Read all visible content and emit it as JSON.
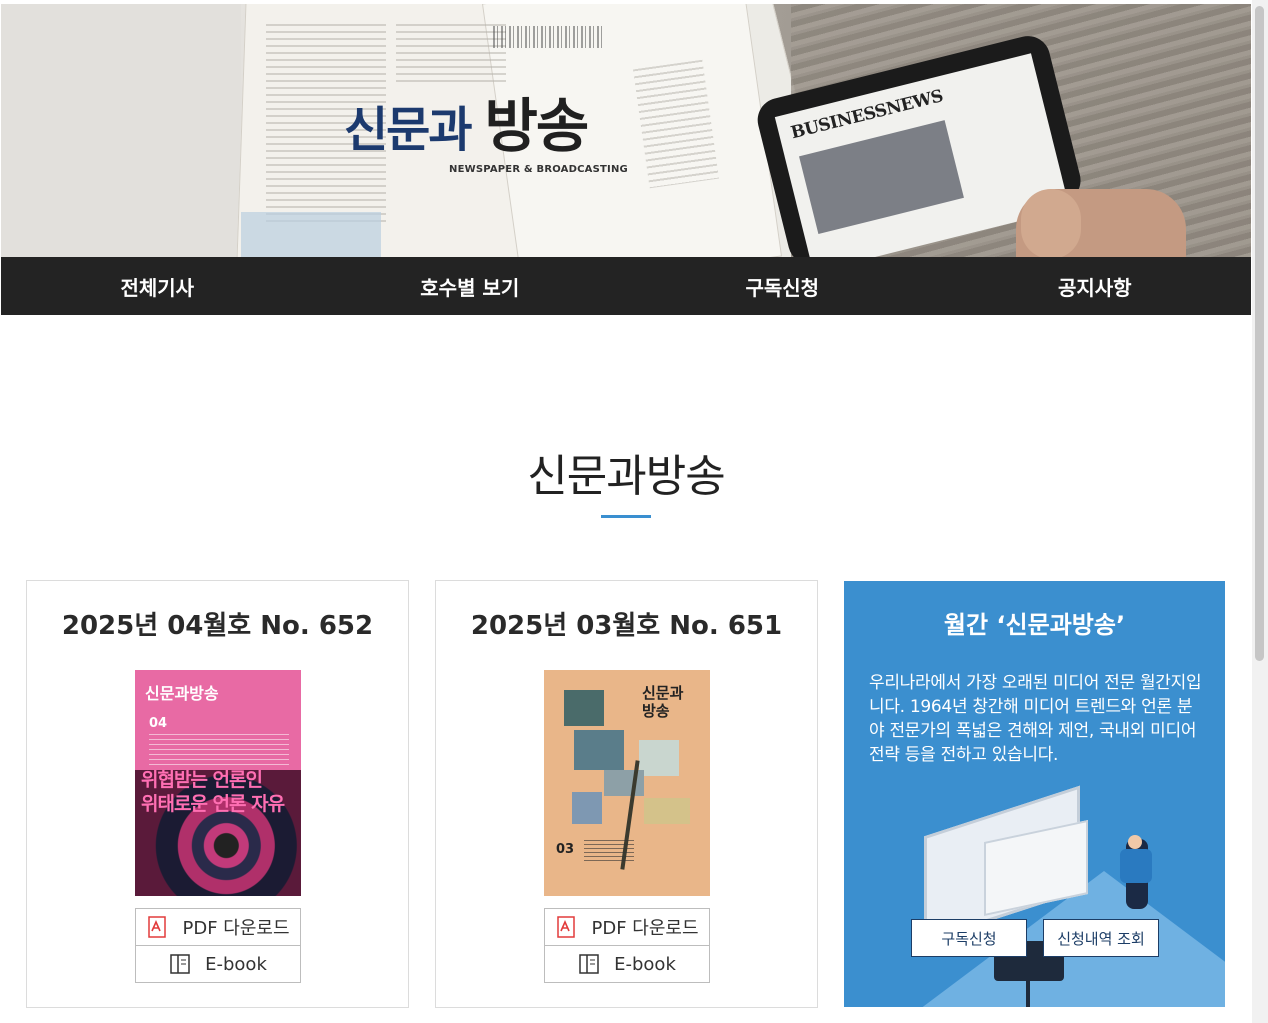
{
  "header": {
    "logo_ko_left": "신문과",
    "logo_ko_right": "방송",
    "logo_en": "NEWSPAPER & BROADCASTING",
    "tablet_headline": "BUSINESSNEWS"
  },
  "nav": {
    "items": [
      {
        "label": "전체기사"
      },
      {
        "label": "호수별 보기"
      },
      {
        "label": "구독신청"
      },
      {
        "label": "공지사항"
      }
    ]
  },
  "main": {
    "title": "신문과방송",
    "accent_color": "#3a8fd0"
  },
  "issues": [
    {
      "title": "2025년 04월호 No. 652",
      "cover_masthead": "신문과방송",
      "cover_number": "04",
      "cover_headline_1": "위협받는 언론인",
      "cover_headline_2": "위태로운 언론 자유",
      "pdf_label": "PDF 다운로드",
      "ebook_label": "E-book"
    },
    {
      "title": "2025년 03월호 No. 651",
      "cover_masthead_1": "신문과",
      "cover_masthead_2": "방송",
      "cover_number": "03",
      "pdf_label": "PDF 다운로드",
      "ebook_label": "E-book"
    }
  ],
  "info": {
    "title": "월간 ‘신문과방송’",
    "description": "우리나라에서 가장 오래된 미디어 전문 월간지입니다. 1964년 창간해 미디어 트렌드와 언론 분야 전문가의 폭넓은 견해와 제언, 국내외 미디어 전략 등을 전하고 있습니다.",
    "subscribe_label": "구독신청",
    "lookup_label": "신청내역 조회",
    "bg_color": "#3b8fcf"
  }
}
